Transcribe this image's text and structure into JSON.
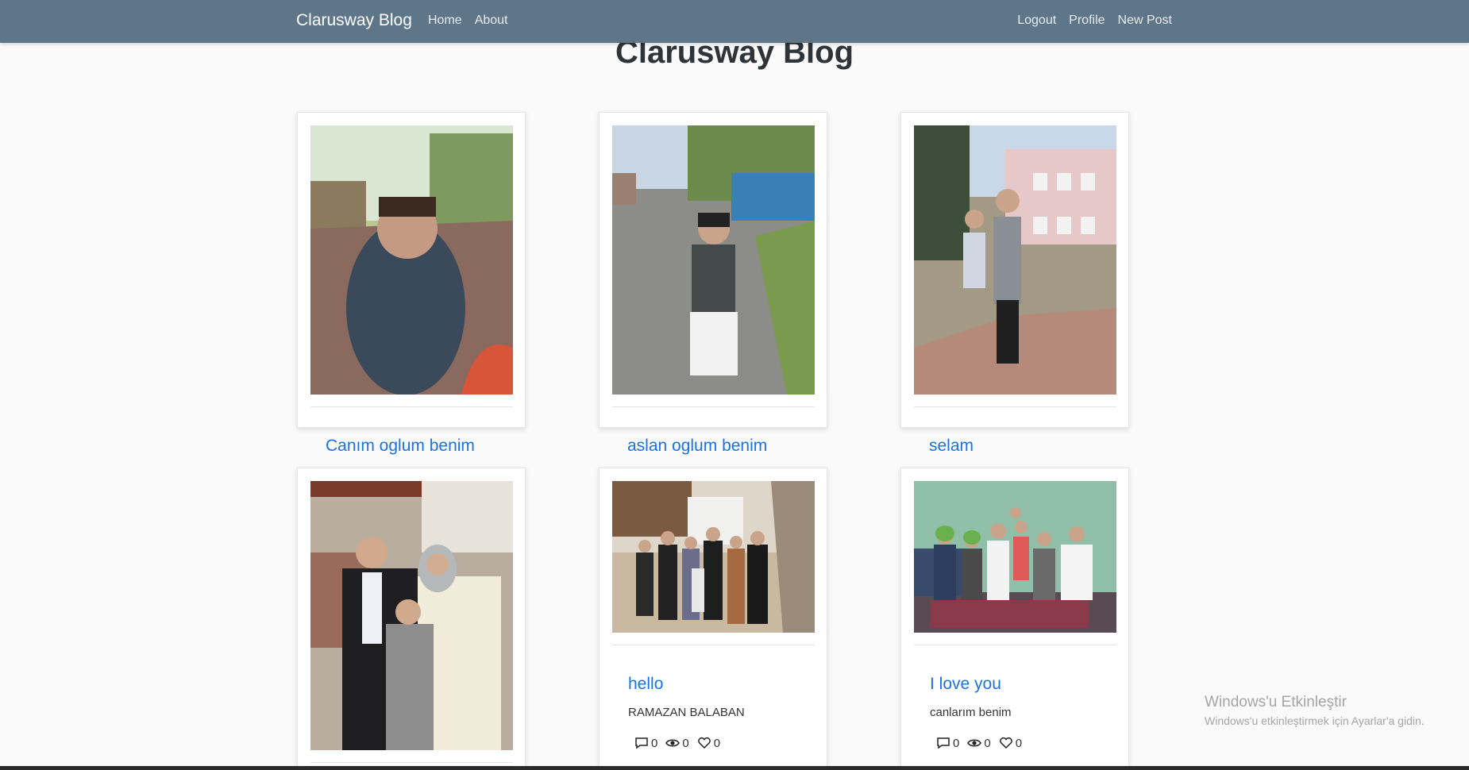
{
  "nav": {
    "brand": "Clarusway Blog",
    "left_links": [
      "Home",
      "About"
    ],
    "right_links": [
      "Logout",
      "Profile",
      "New Post"
    ]
  },
  "page_title": "Clarusway Blog",
  "posts": [
    {
      "title": "Canım oglum benim",
      "image": "boy-in-park-photo"
    },
    {
      "title": "aslan oglum benim",
      "image": "boy-on-street-photo"
    },
    {
      "title": "selam",
      "image": "man-and-boy-photo"
    },
    {
      "title": "",
      "image": "family-portrait-photo"
    },
    {
      "title": "hello",
      "author": "RAMAZAN BALABAN",
      "comments": "0",
      "views": "0",
      "likes": "0",
      "image": "group-photo-courtyard"
    },
    {
      "title": "I love you",
      "author": "canlarım benim",
      "comments": "0",
      "views": "0",
      "likes": "0",
      "image": "family-indoor-photo"
    }
  ],
  "watermark": {
    "line1": "Windows'u Etkinleştir",
    "line2": "Windows'u etkinleştirmek için Ayarlar'a gidin."
  },
  "colors": {
    "navbar": "#5f7689",
    "link": "#1a73e8",
    "background": "#fafafa"
  }
}
